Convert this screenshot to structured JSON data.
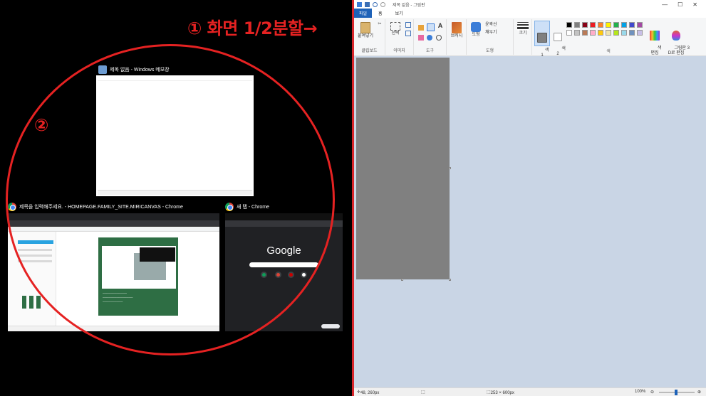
{
  "annotations": {
    "step1": "① 화면 1/2분할→",
    "step2": "②",
    "color": "#e52222"
  },
  "snap_assist": {
    "windows": [
      {
        "title": "제목 없음 - Windows 메모장",
        "icon": "notepad-icon"
      },
      {
        "title": "제목을 입력해주세요. - HOMEPAGE.FAMILY_SITE.MIRICANVAS - Chrome",
        "icon": "chrome-icon"
      },
      {
        "title": "새 탭 - Chrome",
        "icon": "chrome-icon"
      }
    ],
    "new_tab_logo": "Google"
  },
  "paint": {
    "title": "제목 없음 - 그림판",
    "menu": {
      "file": "파일",
      "home": "홈",
      "view": "보기"
    },
    "ribbon": {
      "clipboard": {
        "label": "클립보드",
        "paste": "붙여넣기"
      },
      "image": {
        "label": "이미지",
        "select": "선택"
      },
      "tools": {
        "label": "도구"
      },
      "brushes": {
        "label": "브러시"
      },
      "shapes": {
        "label": "도형",
        "shapes": "도형",
        "outline": "윤곽선",
        "fill": "채우기"
      },
      "size": {
        "label": "크기"
      },
      "color1": "색\n1",
      "color2": "색\n2",
      "colors_label": "색",
      "edit_colors": "색\n편집",
      "paint3d": "그림판 3\nD로 편집"
    },
    "palette": [
      "#000000",
      "#7f7f7f",
      "#880015",
      "#ed1c24",
      "#ff7f27",
      "#fff200",
      "#22b14c",
      "#00a2e8",
      "#3f48cc",
      "#a349a4",
      "#ffffff",
      "#c3c3c3",
      "#b97a57",
      "#ffaec9",
      "#ffc90e",
      "#efe4b0",
      "#b5e61d",
      "#99d9ea",
      "#7092be",
      "#c8bfe7"
    ],
    "status": {
      "position": "48, 260px",
      "size": "253 × 600px",
      "zoom": "100%"
    }
  }
}
